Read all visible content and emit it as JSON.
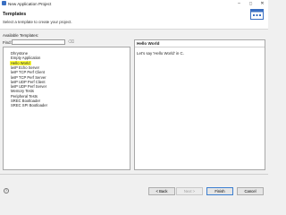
{
  "window": {
    "title": "New Application Project",
    "minimize": "–",
    "maximize": "▢",
    "close": "✕"
  },
  "header": {
    "title": "Templates",
    "subtitle": "Select a template to create your project."
  },
  "templates_section": {
    "label": "Available Templates:"
  },
  "find": {
    "label": "Find:",
    "value": "",
    "placeholder": ""
  },
  "templates": [
    "Dhrystone",
    "Empty Application",
    "Hello World",
    "lwIP Echo Server",
    "lwIP TCP Perf Client",
    "lwIP TCP Perf Server",
    "lwIP UDP Perf Client",
    "lwIP UDP Perf Server",
    "Memory Tests",
    "Peripheral Tests",
    "SREC Bootloader",
    "SREC SPI Bootloader"
  ],
  "selected_template": "Hello World",
  "details": {
    "title": "Hello World",
    "description": "Let's say 'Hello World' in C."
  },
  "buttons": {
    "back": "< Back",
    "next": "Next >",
    "finish": "Finish",
    "cancel": "Cancel"
  },
  "colors": {
    "selection": "#ffff3a",
    "accent": "#3a6fc2"
  }
}
